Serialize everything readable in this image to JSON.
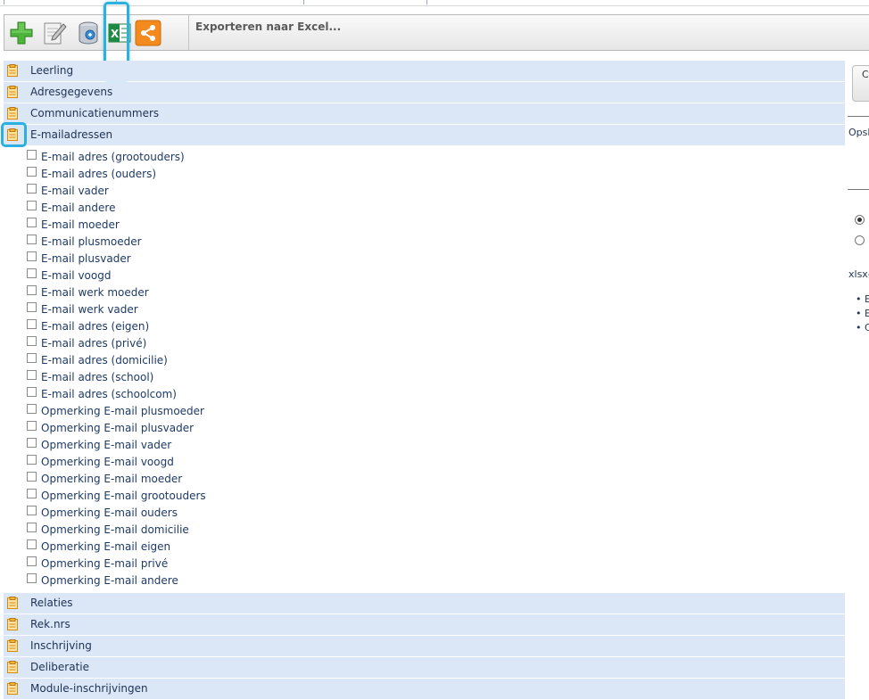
{
  "toolbar": {
    "title": "Exporteren naar Excel...",
    "icons": [
      "add-icon",
      "edit-notepad-icon",
      "database-icon",
      "excel-icon",
      "share-icon"
    ]
  },
  "sections": {
    "leerling": "Leerling",
    "adresgegevens": "Adresgegevens",
    "communicatienummers": "Communicatienummers",
    "emailadressen": "E-mailadressen",
    "relaties": "Relaties",
    "reknrs": "Rek.nrs",
    "inschrijving": "Inschrijving",
    "deliberatie": "Deliberatie",
    "module": "Module-inschrijvingen"
  },
  "email_items": [
    "E-mail adres (grootouders)",
    "E-mail adres (ouders)",
    "E-mail vader",
    "E-mail andere",
    "E-mail moeder",
    "E-mail plusmoeder",
    "E-mail plusvader",
    "E-mail voogd",
    "E-mail werk moeder",
    "E-mail werk vader",
    "E-mail adres (eigen)",
    "E-mail adres (privé)",
    "E-mail adres (domicilie)",
    "E-mail adres (school)",
    "E-mail adres (schoolcom)",
    "Opmerking E-mail plusmoeder",
    "Opmerking E-mail plusvader",
    "Opmerking E-mail vader",
    "Opmerking E-mail voogd",
    "Opmerking E-mail moeder",
    "Opmerking E-mail grootouders",
    "Opmerking E-mail ouders",
    "Opmerking E-mail domicilie",
    "Opmerking E-mail eigen",
    "Opmerking E-mail privé",
    "Opmerking E-mail andere"
  ],
  "right_panel": {
    "button_text": "C",
    "label_1": "Opsl",
    "radio_selected": true,
    "format_text": "xlsx-",
    "bullets": [
      "E",
      "E",
      "C"
    ]
  },
  "colors": {
    "section_header": "#dbe6f6",
    "highlight": "#2cb0e0",
    "text": "#1e3a66"
  }
}
